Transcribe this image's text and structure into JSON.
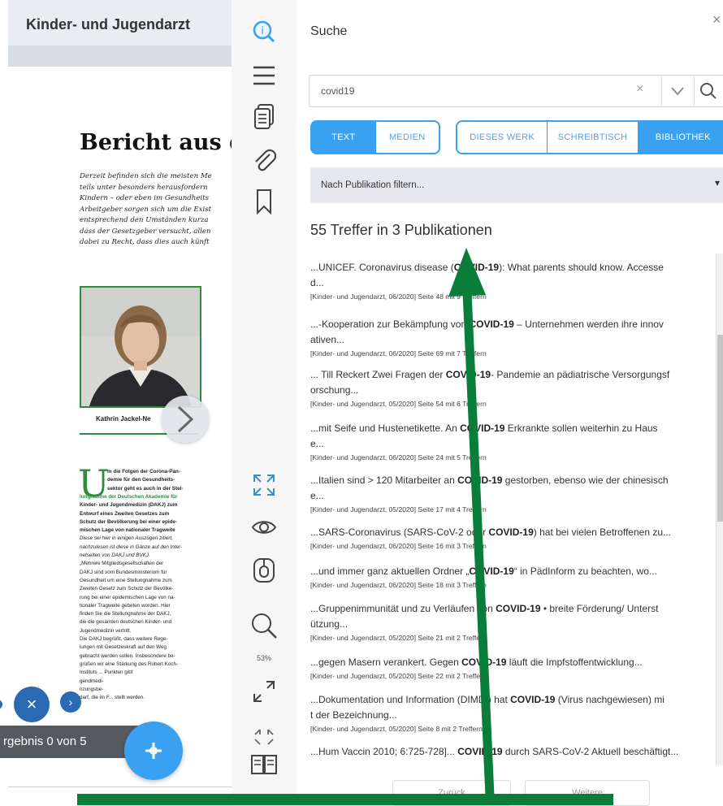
{
  "document": {
    "title": "Kinder- und Jugendarzt",
    "article_heading": "Bericht aus d",
    "intro_lines": [
      "Derzeit befinden sich die meisten Me",
      "teils unter besonders herausfordern",
      "Kindern – oder eben im Gesundheits",
      "Arbeitgeber sorgen sich um die Exist",
      "entsprechend den Umständen kurza",
      "dass der Gesetzgeber versucht, allen",
      "dabei zu Recht, dass dies auch künft"
    ],
    "photo_caption": "Kathrin Jackel-Ne",
    "dropcap": "U",
    "body_lines": [
      {
        "t": "m die Folgen der Corona-Pan-",
        "s": "b"
      },
      {
        "t": "demie für den Gesundheits-",
        "s": "b"
      },
      {
        "t": "sektor geht es auch in der Stel-",
        "s": "b"
      },
      {
        "t": "lungnahme der Deutschen Akademie für",
        "s": "g"
      },
      {
        "t": "Kinder- und Jugendmedizin (DAKJ) zum",
        "s": "b"
      },
      {
        "t": "Entwurf eines Zweiten Gesetzes zum",
        "s": "b"
      },
      {
        "t": "Schutz der Bevölkerung bei einer epide-",
        "s": "b"
      },
      {
        "t": "mischen Lage von nationaler Tragweite",
        "s": "b"
      },
      {
        "t": "Diese sei hier in einigen Auszügen zitiert,",
        "s": "i"
      },
      {
        "t": "nachzulesen ist diese in Gänze auf den Inter-",
        "s": "i"
      },
      {
        "t": "netseiten von DAKJ und BVKJ.",
        "s": "i"
      },
      {
        "t": "„Mehrere Mitgliedsgesellschaften der",
        "s": ""
      },
      {
        "t": "DAKJ sind vom Bundesministerium für",
        "s": ""
      },
      {
        "t": "Gesundheit um eine Stellungnahme zum",
        "s": ""
      },
      {
        "t": "Zweiten Gesetz zum Schutz der Bevölke-",
        "s": ""
      },
      {
        "t": "rung bei einer epidemischen Lage von na-",
        "s": ""
      },
      {
        "t": "tionaler Tragweite gebeten worden. Hier",
        "s": ""
      },
      {
        "t": "finden Sie die Stellungnahme der DAKJ,",
        "s": ""
      },
      {
        "t": "die die gesamten deutschen Kinder- und",
        "s": ""
      },
      {
        "t": "Jugendmedizin vertritt.",
        "s": ""
      },
      {
        "t": "Die DAKJ begrüßt, dass weitere Rege-",
        "s": ""
      },
      {
        "t": "lungen mit Gesetzeskraft auf den Weg",
        "s": ""
      },
      {
        "t": "gebracht werden sollen. Insbesondere be-",
        "s": ""
      },
      {
        "t": "grüßen wir eine Stärkung des Robert Koch-",
        "s": ""
      },
      {
        "t": "Instituts ... Punkten gibt",
        "s": ""
      },
      {
        "t": "gendmedi-",
        "s": ""
      },
      {
        "t": "nzungsbe-",
        "s": ""
      },
      {
        "t": "darf, die im F... stellt werden.",
        "s": ""
      }
    ],
    "result_counter": "rgebnis 0 von 5",
    "close_symbol": "×",
    "next_symbol": "›",
    "fab_icon": "crosshair-plus-icon"
  },
  "toolbar": {
    "zoom_level": "53%",
    "icons": [
      "search-info-icon",
      "menu-icon",
      "documents-icon",
      "paperclip-icon",
      "bookmark-icon",
      "fullscreen-icon",
      "eye-icon",
      "mouse-icon",
      "zoom-icon",
      "expand-icon",
      "collapse-icon",
      "book-pages-icon"
    ]
  },
  "search": {
    "title": "Suche",
    "close": "×",
    "query": "covid19",
    "clear": "×",
    "type_tabs": [
      "TEXT",
      "MEDIEN"
    ],
    "scope_tabs": [
      "DIESES WERK",
      "SCHREIBTISCH",
      "BIBLIOTHEK"
    ],
    "active_type": "TEXT",
    "active_scope": "BIBLIOTHEK",
    "filter_placeholder": "Nach Publikation filtern...",
    "filter_caret": "▾",
    "summary": "55 Treffer in 3 Publikationen",
    "results": [
      {
        "pre": "...UNICEF. Coronavirus disease (",
        "hl": "COVID-19",
        "post": "): What parents should know. Accesse",
        "post2": "d...",
        "meta": "[Kinder- und Jugendarzt, 06/2020] Seite 48 mit 9 Treffern"
      },
      {
        "pre": "...-Kooperation zur Bekämpfung von ",
        "hl": "COVID-19",
        "post": " – Unternehmen werden ihre innov",
        "post2": "ativen...",
        "meta": "[Kinder- und Jugendarzt, 06/2020] Seite 69 mit 7 Treffern"
      },
      {
        "pre": "... Till Reckert Zwei Fragen der ",
        "hl": "COVID-19",
        "post": "- Pandemie an pädiatrische Versorgungsf",
        "post2": "orschung...",
        "meta": "[Kinder- und Jugendarzt, 05/2020] Seite 54 mit 6 Treffern"
      },
      {
        "pre": "...mit Seife und Hustenetikette. An ",
        "hl": "COVID-19",
        "post": " Erkrankte sollen weiterhin zu Haus",
        "post2": "e...",
        "meta": "[Kinder- und Jugendarzt, 06/2020] Seite 24 mit 5 Treffern"
      },
      {
        "pre": "...Italien sind > 120 Mitarbeiter an ",
        "hl": "COVID-19",
        "post": " gestorben, ebenso wie der chinesisch",
        "post2": "e...",
        "meta": "[Kinder- und Jugendarzt, 05/2020] Seite 17 mit 4 Treffern"
      },
      {
        "pre": "...SARS-Coronavirus (SARS-CoV-2 oder ",
        "hl": "COVID-19",
        "post": ") hat bei vielen Betroffenen zu...",
        "post2": "",
        "meta": "[Kinder- und Jugendarzt, 06/2020] Seite 16 mit 3 Treffern"
      },
      {
        "pre": "...und immer ganz aktuellen Ordner „",
        "hl": "COVID-19",
        "post": "“ in PädInform zu beachten, wo...",
        "post2": "",
        "meta": "[Kinder- und Jugendarzt, 06/2020] Seite 18 mit 3 Treffern"
      },
      {
        "pre": "...Gruppenimmunität und zu Verläufen von ",
        "hl": "COVID-19",
        "post": " • breite Förderung/ Unterst",
        "post2": "ützung...",
        "meta": "[Kinder- und Jugendarzt, 05/2020] Seite 21 mit 2 Treffern"
      },
      {
        "pre": "...gegen Masern verankert. Gegen ",
        "hl": "COVID-19",
        "post": " läuft die Impfstoffentwicklung...",
        "post2": "",
        "meta": "[Kinder- und Jugendarzt, 05/2020] Seite 22 mit 2 Treffern"
      },
      {
        "pre": "...Dokumentation und Information (DIMDI) hat ",
        "hl": "COVID-19",
        "post": " (Virus nachgewiesen) mi",
        "post2": "t der Bezeichnung...",
        "meta": "[Kinder- und Jugendarzt, 05/2020] Seite 8 mit 2 Treffern"
      },
      {
        "pre": "...Hum Vaccin 2010; 6:725-728]... ",
        "hl": "COVID-19",
        "post": " durch SARS-CoV-2 Aktuell beschäftigt...",
        "post2": "",
        "meta": ""
      }
    ],
    "footer_buttons": [
      "Zurück",
      "Weitere"
    ]
  },
  "overlay": {
    "color": "#0a7d3a"
  }
}
